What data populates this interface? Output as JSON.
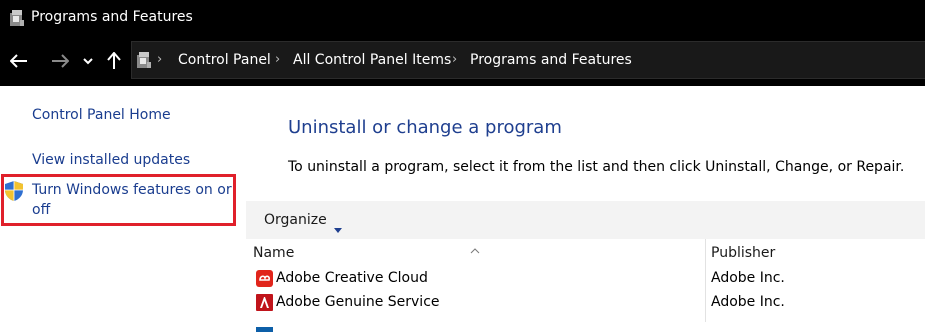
{
  "window": {
    "title": "Programs and Features"
  },
  "address": {
    "crumbs": [
      "Control Panel",
      "All Control Panel Items",
      "Programs and Features"
    ]
  },
  "sidebar": {
    "home": "Control Panel Home",
    "updates": "View installed updates",
    "features_line1": "Turn Windows features on or",
    "features_line2": "off"
  },
  "main": {
    "title": "Uninstall or change a program",
    "description": "To uninstall a program, select it from the list and then click Uninstall, Change, or Repair."
  },
  "toolbar": {
    "organize": "Organize"
  },
  "list": {
    "columns": {
      "name": "Name",
      "publisher": "Publisher"
    },
    "rows": [
      {
        "name": "Adobe Creative Cloud",
        "publisher": "Adobe Inc.",
        "icon": "adobe-creative-cloud-icon"
      },
      {
        "name": "Adobe Genuine Service",
        "publisher": "Adobe Inc.",
        "icon": "adobe-genuine-service-icon"
      }
    ]
  },
  "colors": {
    "link": "#1a3d8f",
    "highlight": "#e0202a",
    "adobe": "#e1251b"
  }
}
